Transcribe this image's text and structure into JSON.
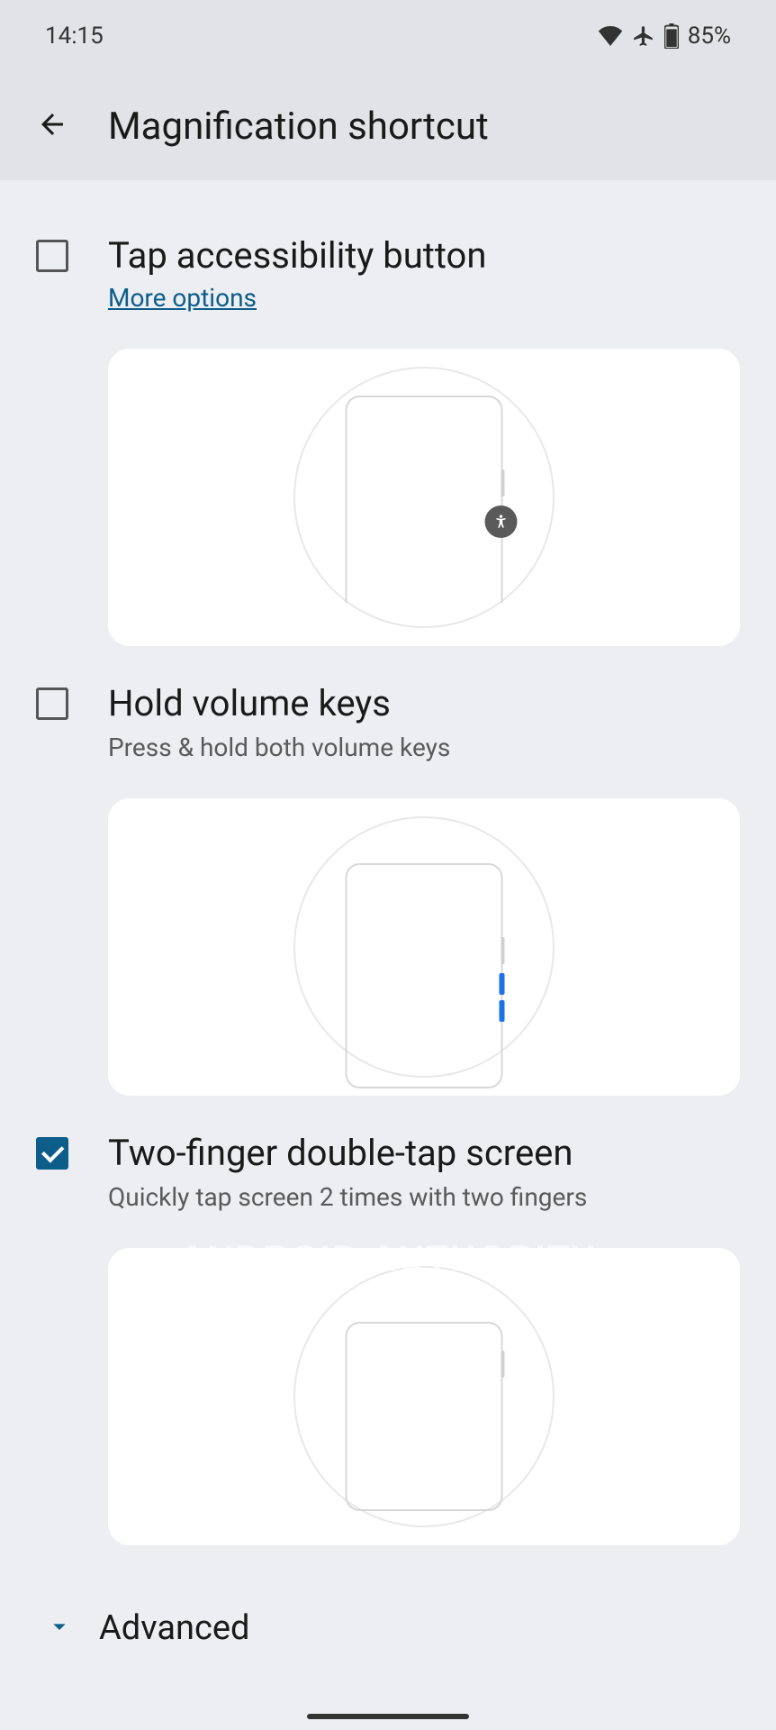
{
  "statusbar": {
    "time": "14:15",
    "battery": "85%"
  },
  "header": {
    "title": "Magnification shortcut"
  },
  "options": [
    {
      "title": "Tap accessibility button",
      "link": "More options",
      "checked": false
    },
    {
      "title": "Hold volume keys",
      "subtitle": "Press & hold both volume keys",
      "checked": false
    },
    {
      "title": "Two-finger double-tap screen",
      "subtitle": "Quickly tap screen 2 times with two fingers",
      "checked": true
    }
  ],
  "advanced": {
    "label": "Advanced"
  },
  "watermark": "ANDROID AUTHORITY"
}
